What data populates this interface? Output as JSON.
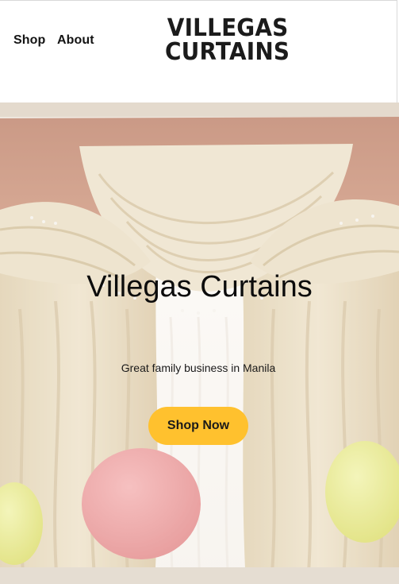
{
  "nav": {
    "shop_label": "Shop",
    "about_label": "About"
  },
  "logo": {
    "line1": "VILLEGAS",
    "line2": "CURTAINS"
  },
  "hero": {
    "title": "Villegas Curtains",
    "subtitle": "Great family business in Manila",
    "cta_label": "Shop Now"
  },
  "colors": {
    "cta_background": "#ffc12e",
    "header_background": "#ffffff",
    "text": "#141414"
  }
}
